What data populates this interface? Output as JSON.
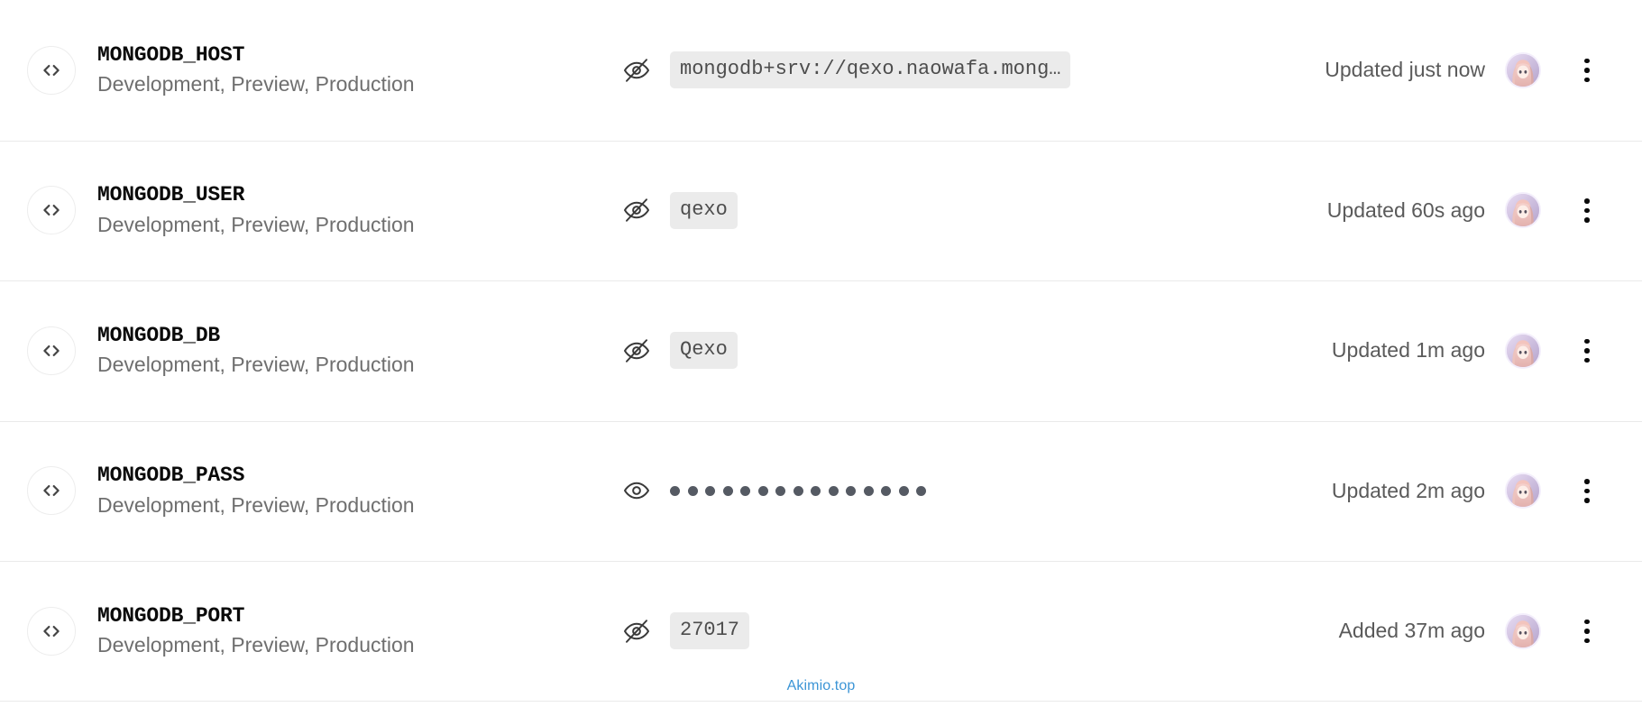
{
  "watermark": {
    "text": "Akimio.top",
    "color": "#3c95d6"
  },
  "colors": {
    "row_divider": "#eaeaea",
    "chip_background": "#ebebeb",
    "chip_text": "#4d4d4d",
    "key_text": "#0a0a0a",
    "scope_text": "#6f6f6f",
    "timestamp_text": "#5a5a5a",
    "dot_color": "#555a63",
    "avatar_ring": "#f3eefb"
  },
  "icons": {
    "code": "code-brackets-icon",
    "eye_hidden": "eye-off-icon",
    "eye_visible": "eye-icon",
    "more": "more-vertical-icon",
    "avatar": "user-avatar"
  },
  "env_rows": [
    {
      "key": "MONGODB_HOST",
      "scopes": "Development, Preview, Production",
      "value": "mongodb+srv://qexo.naowafa.mong…",
      "value_type": "chip",
      "visibility": "hidden",
      "eye_icon": "eye-off-icon",
      "timestamp": "Updated just now"
    },
    {
      "key": "MONGODB_USER",
      "scopes": "Development, Preview, Production",
      "value": "qexo",
      "value_type": "chip",
      "visibility": "hidden",
      "eye_icon": "eye-off-icon",
      "timestamp": "Updated 60s ago"
    },
    {
      "key": "MONGODB_DB",
      "scopes": "Development, Preview, Production",
      "value": "Qexo",
      "value_type": "chip",
      "visibility": "hidden",
      "eye_icon": "eye-off-icon",
      "timestamp": "Updated 1m ago"
    },
    {
      "key": "MONGODB_PASS",
      "scopes": "Development, Preview, Production",
      "value": "",
      "value_type": "dots",
      "dot_count": 15,
      "visibility": "visible",
      "eye_icon": "eye-icon",
      "timestamp": "Updated 2m ago"
    },
    {
      "key": "MONGODB_PORT",
      "scopes": "Development, Preview, Production",
      "value": "27017",
      "value_type": "chip",
      "visibility": "hidden",
      "eye_icon": "eye-off-icon",
      "timestamp": "Added 37m ago"
    }
  ]
}
